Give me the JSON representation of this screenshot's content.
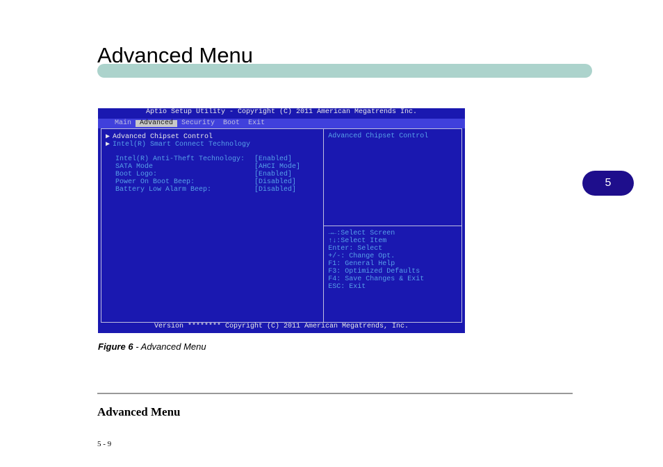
{
  "title": "Advanced Menu",
  "banner": "",
  "badge": "5",
  "bios": {
    "header": "Aptio Setup Utility - Copyright (C) 2011 American Megatrends Inc.",
    "tabs": [
      "Main",
      "Advanced",
      "Security",
      "Boot",
      "Exit"
    ],
    "active_tab_index": 1,
    "submenus": [
      "Advanced Chipset Control",
      "Intel(R) Smart Connect Technology"
    ],
    "settings": [
      {
        "k": "Intel(R) Anti-Theft Technology:",
        "v": "[Enabled]"
      },
      {
        "k": "SATA Mode",
        "v": "[AHCI Mode]"
      },
      {
        "k": "Boot Logo:",
        "v": "[Enabled]"
      },
      {
        "k": "Power On Boot Beep:",
        "v": "[Disabled]"
      },
      {
        "k": "Battery Low Alarm Beep:",
        "v": "[Disabled]"
      }
    ],
    "help_title": "Advanced Chipset Control",
    "help_keys": [
      "→←:Select Screen",
      "↑↓:Select Item",
      "Enter: Select",
      "+/-: Change Opt.",
      "F1: General Help",
      "F3: Optimized Defaults",
      "F4: Save Changes & Exit",
      "ESC: Exit"
    ],
    "footer": "Version ******** Copyright (C) 2011 American Megatrends, Inc."
  },
  "caption_bold": "Figure 6",
  "caption_text": " - Advanced Menu",
  "foot_section": "Advanced Menu",
  "foot_page": "5 - 9"
}
